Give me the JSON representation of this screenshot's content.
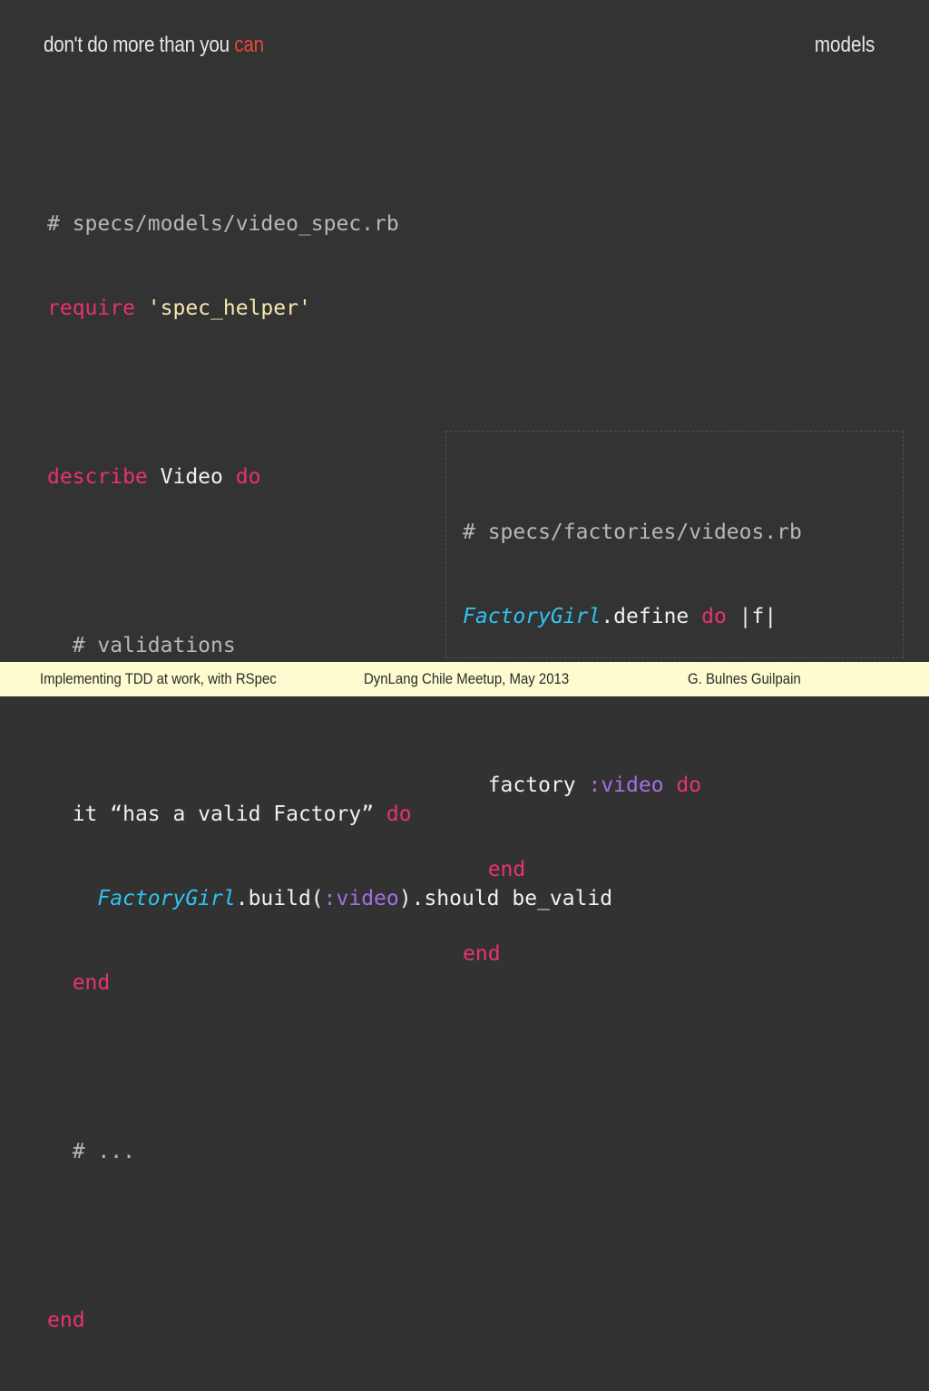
{
  "header": {
    "title_prefix": "don't do more than you ",
    "title_accent": "can",
    "section": "models"
  },
  "code_main": {
    "l1": "# specs/models/video_spec.rb",
    "l2_kw": "require",
    "l2_str": "'spec_helper'",
    "l4_kw1": "describe",
    "l4_name": " Video ",
    "l4_kw2": "do",
    "l6": "# validations",
    "l8_it": "it “has a valid Factory” ",
    "l8_do": "do",
    "l9_const": "FactoryGirl",
    "l9_a": ".build(",
    "l9_sym": ":video",
    "l9_b": ").should be_valid",
    "l10": "end",
    "l12": "# ...",
    "l14": "end"
  },
  "code_factory": {
    "l1": "# specs/factories/videos.rb",
    "l2_const": "FactoryGirl",
    "l2_a": ".define ",
    "l2_do": "do",
    "l2_b": " |f|",
    "l4_a": "factory ",
    "l4_sym": ":video",
    "l4_do": " do",
    "l5": "end",
    "l6": "end"
  },
  "footer": {
    "talk": "Implementing TDD at work, with RSpec",
    "event": "DynLang Chile Meetup, May 2013",
    "author": "G. Bulnes Guilpain"
  },
  "colors": {
    "background": "#333333",
    "keyword": "#e8336b",
    "string": "#f7e7b0",
    "constant": "#2ec4f2",
    "symbol": "#a46fe0",
    "comment": "#b8b8b8",
    "title_accent": "#e8463a",
    "footer": "#fdfbd0"
  }
}
